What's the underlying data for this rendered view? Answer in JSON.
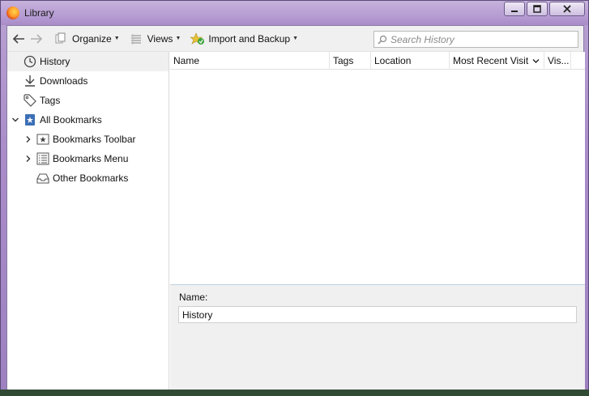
{
  "window": {
    "title": "Library",
    "buttons": {
      "minimize": "▁",
      "maximize": "☐",
      "close": "✕"
    }
  },
  "toolbar": {
    "organize_label": "Organize",
    "views_label": "Views",
    "import_label": "Import and Backup",
    "search_placeholder": "Search History"
  },
  "sidebar": {
    "items": [
      {
        "label": "History",
        "icon": "clock-icon"
      },
      {
        "label": "Downloads",
        "icon": "download-icon"
      },
      {
        "label": "Tags",
        "icon": "tag-icon"
      },
      {
        "label": "All Bookmarks",
        "icon": "bookmarks-icon"
      },
      {
        "label": "Bookmarks Toolbar",
        "icon": "star-folder-icon"
      },
      {
        "label": "Bookmarks Menu",
        "icon": "menu-folder-icon"
      },
      {
        "label": "Other Bookmarks",
        "icon": "tray-icon"
      }
    ]
  },
  "columns": [
    "Name",
    "Tags",
    "Location",
    "Most Recent Visit",
    "Vis..."
  ],
  "details": {
    "name_label": "Name:",
    "name_value": "History"
  },
  "colors": {
    "titlebar": "#b79dd3",
    "selection": "#f0f0f0",
    "toolbar_bg": "#f0f0f0"
  }
}
